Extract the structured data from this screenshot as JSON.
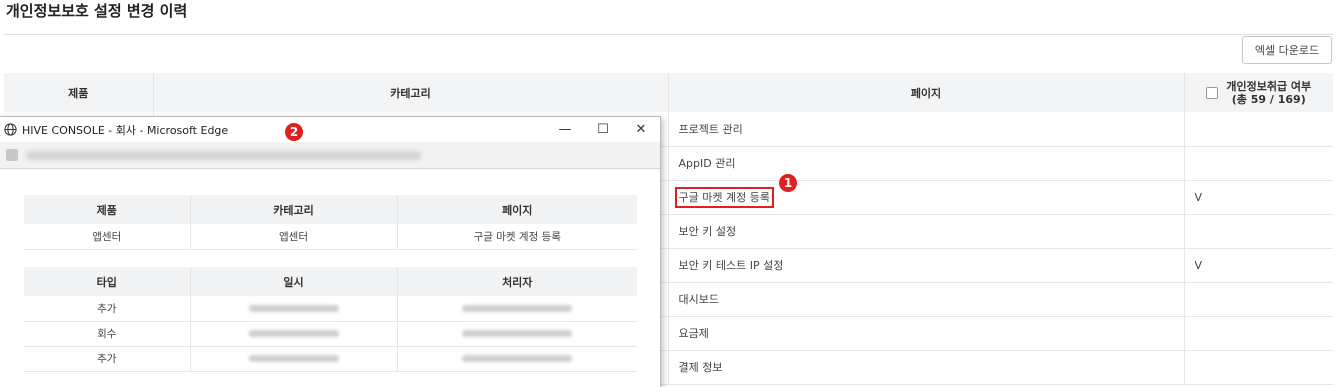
{
  "page": {
    "title": "개인정보보호 설정 변경 이력",
    "excel_button": "엑셀 다운로드"
  },
  "table": {
    "headers": {
      "product": "제품",
      "category": "카테고리",
      "page": "페이지",
      "privacy_line1": "개인정보취급 여부",
      "privacy_line2": "(총 59 / 169)"
    },
    "rows": [
      {
        "page": "프로젝트 관리",
        "privacy": ""
      },
      {
        "page": "AppID 관리",
        "privacy": ""
      },
      {
        "page": "구글 마켓 계정 등록",
        "privacy": "V"
      },
      {
        "page": "보안 키 설정",
        "privacy": ""
      },
      {
        "page": "보안 키 테스트 IP 설정",
        "privacy": "V"
      },
      {
        "page": "대시보드",
        "privacy": ""
      },
      {
        "page": "요금제",
        "privacy": ""
      },
      {
        "page": "결제 정보",
        "privacy": ""
      }
    ]
  },
  "badges": {
    "one": "1",
    "two": "2"
  },
  "popup": {
    "window_title": "HIVE CONSOLE - 회사 - Microsoft Edge",
    "controls": {
      "minimize": "—",
      "maximize": "☐",
      "close": "✕"
    },
    "info_headers": {
      "product": "제품",
      "category": "카테고리",
      "page": "페이지"
    },
    "info_row": {
      "product": "앱센터",
      "category": "앱센터",
      "page": "구글 마켓 계정 등록"
    },
    "history_headers": {
      "type": "타입",
      "date": "일시",
      "handler": "처리자"
    },
    "history_rows": [
      {
        "type": "추가"
      },
      {
        "type": "회수"
      },
      {
        "type": "추가"
      }
    ]
  },
  "colors": {
    "accent_red": "#e02020",
    "header_bg": "#f3f4f6"
  },
  "icons": {
    "browser": "globe-icon"
  }
}
